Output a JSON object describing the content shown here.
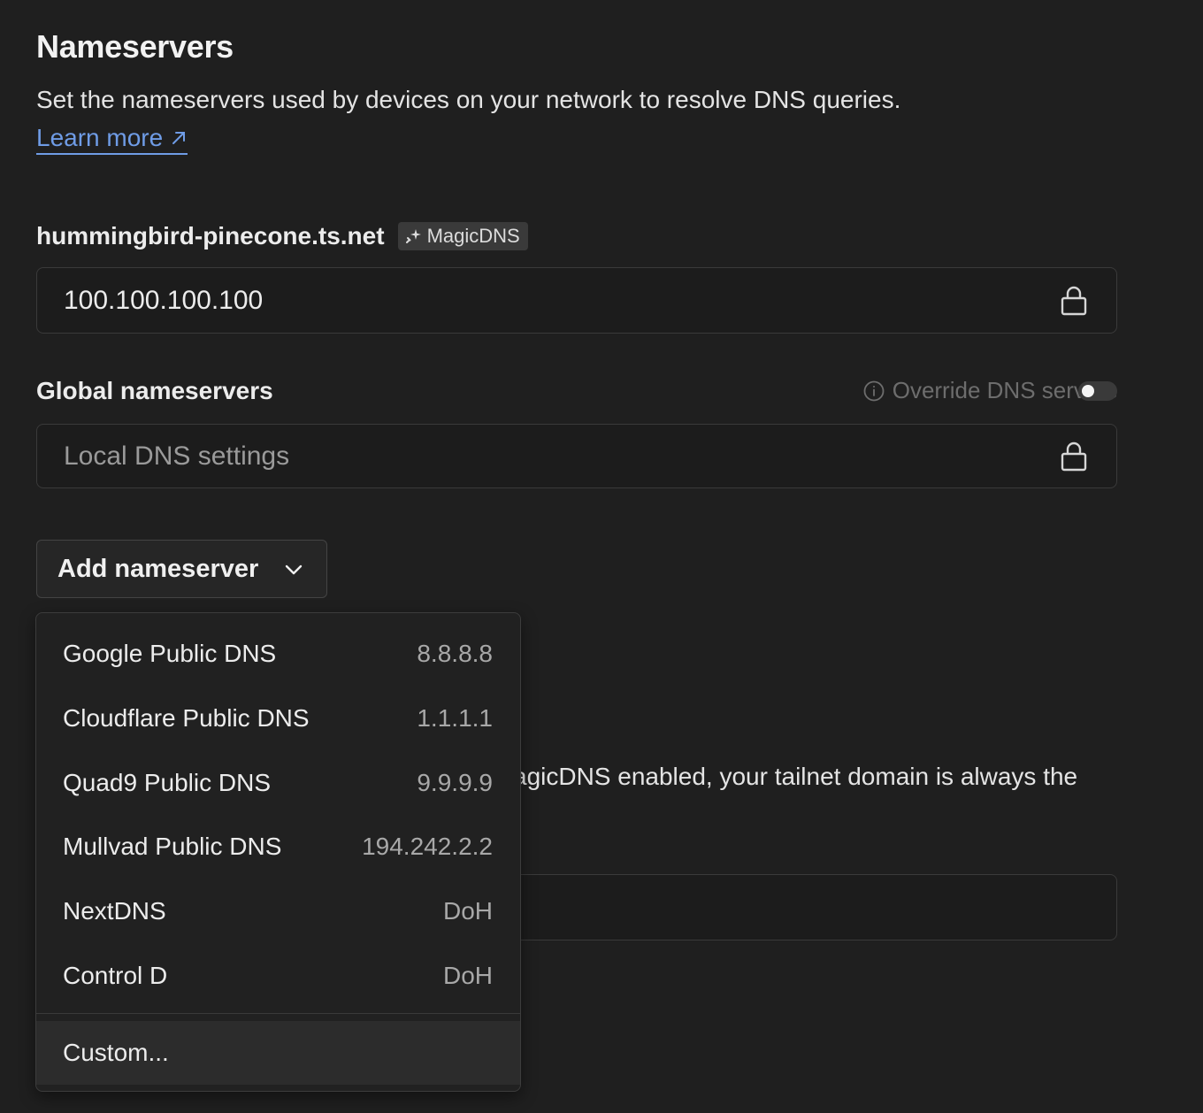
{
  "section": {
    "title": "Nameservers",
    "description": "Set the nameservers used by devices on your network to resolve DNS queries.",
    "learn_more": "Learn more"
  },
  "magicdns": {
    "domain": "hummingbird-pinecone.ts.net",
    "badge": "MagicDNS",
    "address": "100.100.100.100"
  },
  "global": {
    "label": "Global nameservers",
    "override_label": "Override DNS servers",
    "override_enabled": false,
    "placeholder": "Local DNS settings"
  },
  "add_button": {
    "label": "Add nameserver"
  },
  "dropdown": {
    "items": [
      {
        "name": "Google Public DNS",
        "value": "8.8.8.8"
      },
      {
        "name": "Cloudflare Public DNS",
        "value": "1.1.1.1"
      },
      {
        "name": "Quad9 Public DNS",
        "value": "9.9.9.9"
      },
      {
        "name": "Mullvad Public DNS",
        "value": "194.242.2.2"
      },
      {
        "name": "NextDNS",
        "value": "DoH"
      },
      {
        "name": "Control D",
        "value": "DoH"
      }
    ],
    "custom": "Custom..."
  },
  "background": {
    "partial_text": "agicDNS enabled, your tailnet domain is always the"
  }
}
